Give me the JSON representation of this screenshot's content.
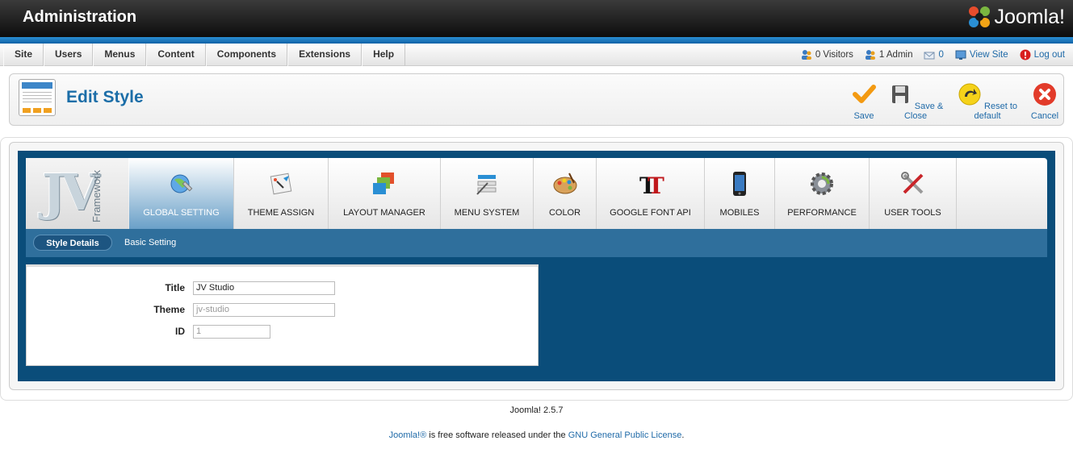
{
  "header": {
    "title": "Administration",
    "brand": "Joomla!"
  },
  "menu": [
    "Site",
    "Users",
    "Menus",
    "Content",
    "Components",
    "Extensions",
    "Help"
  ],
  "status": {
    "visitors": "0 Visitors",
    "admin": "1 Admin",
    "messages": "0",
    "view_site": "View Site",
    "logout": "Log out"
  },
  "toolbar": {
    "page_title": "Edit Style",
    "save": "Save",
    "save_close": "Save & Close",
    "reset": "Reset to default",
    "cancel": "Cancel"
  },
  "framework": {
    "logo": "JV",
    "logo_sub": "Framework"
  },
  "tabs": [
    "GLOBAL SETTING",
    "THEME ASSIGN",
    "LAYOUT MANAGER",
    "MENU SYSTEM",
    "COLOR",
    "GOOGLE FONT API",
    "MOBILES",
    "PERFORMANCE",
    "USER TOOLS"
  ],
  "subtabs": [
    "Style Details",
    "Basic Setting"
  ],
  "form": {
    "title_label": "Title",
    "title_value": "JV Studio",
    "theme_label": "Theme",
    "theme_value": "jv-studio",
    "id_label": "ID",
    "id_value": "1"
  },
  "footer": {
    "version": "Joomla! 2.5.7",
    "license_prefix": "Joomla!®",
    "license_mid": " is free software released under the ",
    "license_link": "GNU General Public License",
    "license_end": "."
  },
  "colors": {
    "accent": "#1c6ea8",
    "panel_blue": "#0a4d7a",
    "subbar": "#2f6f9c"
  }
}
